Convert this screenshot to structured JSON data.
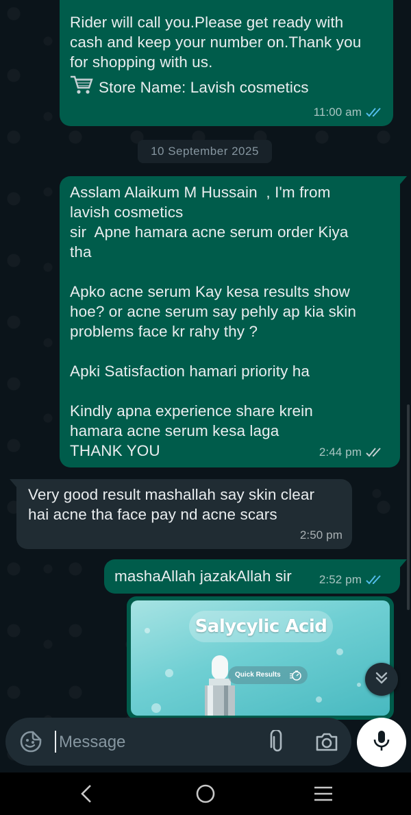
{
  "messages": {
    "msg1": {
      "text": "Rider will call you.Please get ready with\ncash and keep your number on.Thank you\nfor shopping with us.",
      "store_line": "Store Name: Lavish cosmetics",
      "time": "11:00 am",
      "read": true
    },
    "date_separator": "10 September 2025",
    "msg2": {
      "text": "Asslam Alaikum M Hussain  , I'm from\nlavish cosmetics\nsir  Apne hamara acne serum order Kiya\ntha\n\nApko acne serum Kay kesa results show\nhoe? or acne serum say pehly ap kia skin\nproblems face kr rahy thy ?\n\nApki Satisfaction hamari priority ha\n\nKindly apna experience share krein\nhamara acne serum kesa laga\nTHANK YOU",
      "time": "2:44 pm",
      "read": false
    },
    "msg3": {
      "text": "Very good result mashallah say skin clear\nhai acne tha face pay nd acne scars",
      "time": "2:50 pm"
    },
    "msg4": {
      "text": "mashaAllah jazakAllah sir",
      "time": "2:52 pm",
      "read": true
    },
    "image_msg": {
      "title": "Salycylic Acid",
      "tag": "Quick Results"
    }
  },
  "composer": {
    "placeholder": "Message"
  },
  "colors": {
    "outgoing_bubble": "#005c4b",
    "incoming_bubble": "#202c33",
    "read_tick": "#53bdeb",
    "background": "#0b141a"
  },
  "icons": [
    "cart-emoji",
    "double-check-icon",
    "chevron-double-down-icon",
    "sticker-icon",
    "paperclip-icon",
    "camera-icon",
    "mic-icon",
    "back-nav-icon",
    "home-nav-icon",
    "recents-nav-icon"
  ]
}
